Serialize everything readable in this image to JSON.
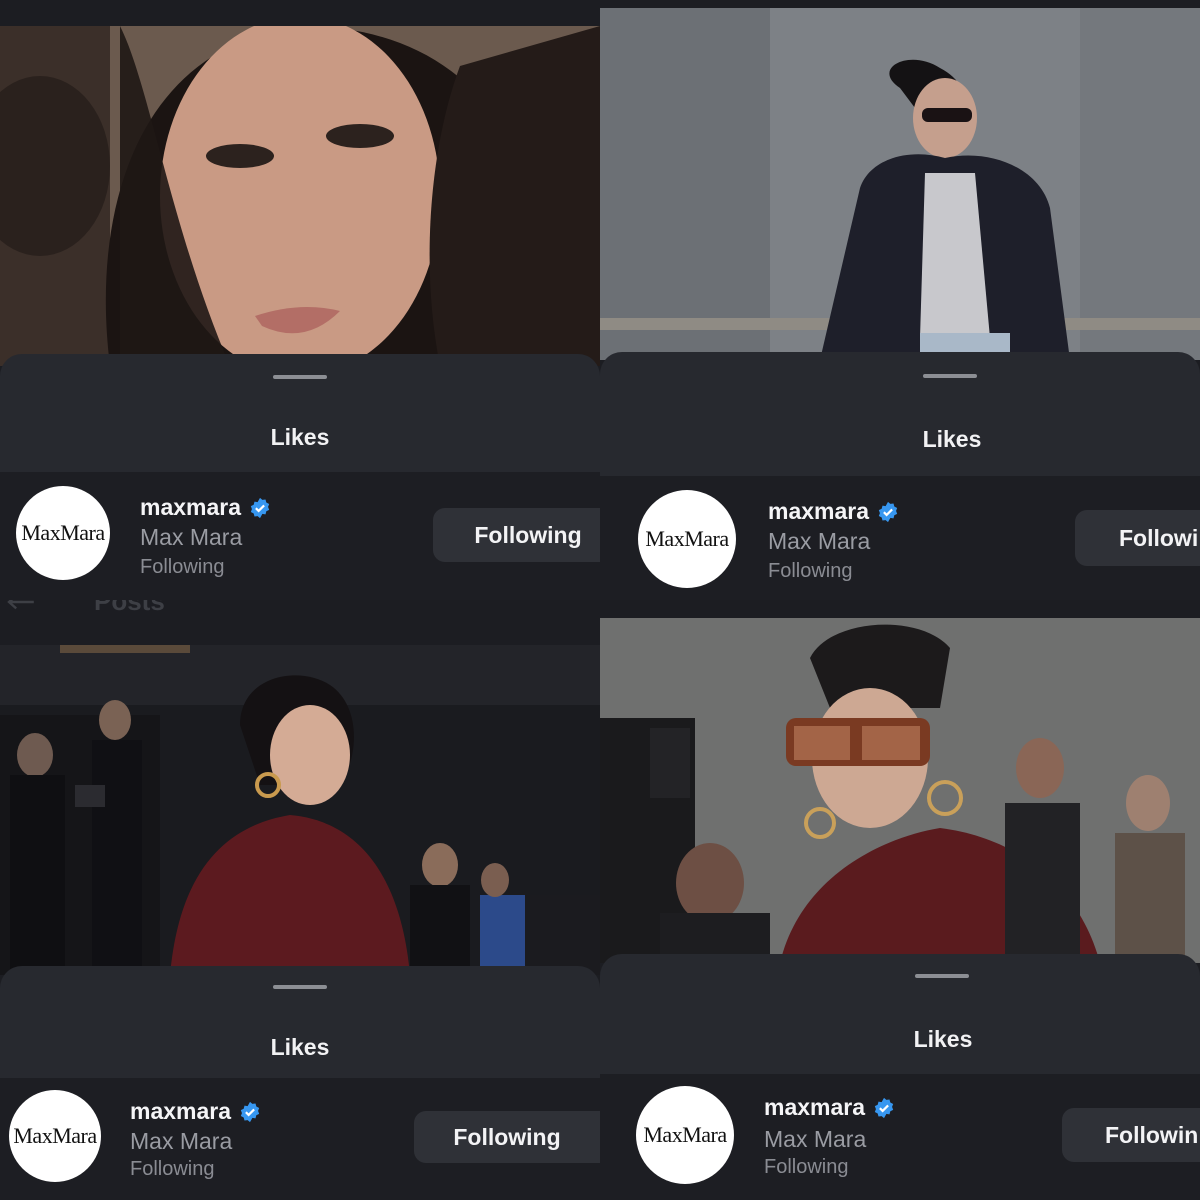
{
  "panels": [
    {
      "photo": "woman-close-up-portrait",
      "sheet_title": "Likes",
      "account": {
        "username": "maxmara",
        "full_name": "Max Mara",
        "status": "Following",
        "avatar_text": "MaxMara",
        "button_label": "Following"
      }
    },
    {
      "photo": "woman-sunglasses-blazer-leaning-rail",
      "sheet_title": "Likes",
      "account": {
        "username": "maxmara",
        "full_name": "Max Mara",
        "status": "Following",
        "avatar_text": "MaxMara",
        "button_label": "Followi"
      }
    },
    {
      "photo": "woman-burgundy-velvet-shirt-event",
      "sheet_title": "Likes",
      "header_partial": "Posts",
      "account": {
        "username": "maxmara",
        "full_name": "Max Mara",
        "status": "Following",
        "avatar_text": "MaxMara",
        "button_label": "Following"
      }
    },
    {
      "photo": "woman-brown-sunglasses-front-row",
      "sheet_title": "Likes",
      "account": {
        "username": "maxmara",
        "full_name": "Max Mara",
        "status": "Following",
        "avatar_text": "MaxMara",
        "button_label": "Followin"
      }
    }
  ],
  "colors": {
    "sheet_bg": "#27292f",
    "row_bg": "#1d1e23",
    "button_bg": "#2f3137",
    "verified_blue": "#3797f0",
    "text_primary": "#f5f5f7",
    "text_secondary": "#9a9ca3"
  },
  "icons": {
    "verified": "verified-badge-icon",
    "back": "back-arrow-icon"
  }
}
